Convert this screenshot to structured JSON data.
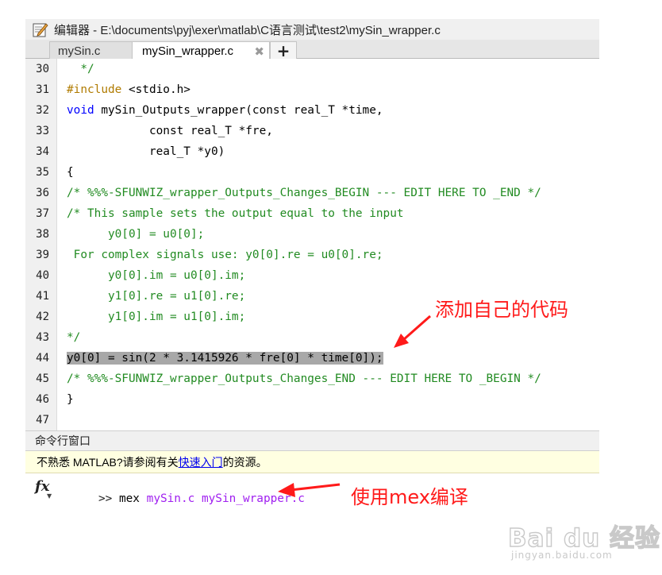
{
  "window": {
    "title": "编辑器 - E:\\documents\\pyj\\exer\\matlab\\C语言测试\\test2\\mySin_wrapper.c"
  },
  "tabs": [
    {
      "label": "mySin.c",
      "close": "✖"
    },
    {
      "label": "mySin_wrapper.c",
      "close": "✖"
    }
  ],
  "tab_add_label": "+",
  "editor": {
    "lines": [
      {
        "num": "30",
        "segments": [
          {
            "text": "  */",
            "style": "comment"
          }
        ]
      },
      {
        "num": "31",
        "segments": [
          {
            "text": "#include",
            "style": "pre"
          },
          {
            "text": " <stdio.h>",
            "style": "normal"
          }
        ]
      },
      {
        "num": "32",
        "segments": [
          {
            "text": "void",
            "style": "keyword"
          },
          {
            "text": " mySin_Outputs_wrapper(const real_T *time,",
            "style": "normal"
          }
        ]
      },
      {
        "num": "33",
        "segments": [
          {
            "text": "            const real_T *fre,",
            "style": "normal"
          }
        ]
      },
      {
        "num": "34",
        "segments": [
          {
            "text": "            real_T *y0)",
            "style": "normal"
          }
        ]
      },
      {
        "num": "35",
        "segments": [
          {
            "text": "{",
            "style": "normal"
          }
        ]
      },
      {
        "num": "36",
        "segments": [
          {
            "text": "/* %%%-SFUNWIZ_wrapper_Outputs_Changes_BEGIN --- EDIT HERE TO _END */",
            "style": "comment"
          }
        ]
      },
      {
        "num": "37",
        "segments": [
          {
            "text": "/* This sample sets the output equal to the input",
            "style": "comment"
          }
        ]
      },
      {
        "num": "38",
        "segments": [
          {
            "text": "      y0[0] = u0[0];",
            "style": "comment"
          }
        ]
      },
      {
        "num": "39",
        "segments": [
          {
            "text": " For complex signals use: y0[0].re = u0[0].re;",
            "style": "comment"
          }
        ]
      },
      {
        "num": "40",
        "segments": [
          {
            "text": "      y0[0].im = u0[0].im;",
            "style": "comment"
          }
        ]
      },
      {
        "num": "41",
        "segments": [
          {
            "text": "      y1[0].re = u1[0].re;",
            "style": "comment"
          }
        ]
      },
      {
        "num": "42",
        "segments": [
          {
            "text": "      y1[0].im = u1[0].im;",
            "style": "comment"
          }
        ]
      },
      {
        "num": "43",
        "segments": [
          {
            "text": "*/",
            "style": "comment"
          }
        ]
      },
      {
        "num": "44",
        "segments": [
          {
            "text": "y0[0] = sin(2 * 3.1415926 * fre[0] * time[0]);",
            "style": "hl"
          }
        ]
      },
      {
        "num": "45",
        "segments": [
          {
            "text": "/* %%%-SFUNWIZ_wrapper_Outputs_Changes_END --- EDIT HERE TO _BEGIN */",
            "style": "comment"
          }
        ]
      },
      {
        "num": "46",
        "segments": [
          {
            "text": "}",
            "style": "normal"
          }
        ]
      },
      {
        "num": "47",
        "segments": [
          {
            "text": "",
            "style": "normal"
          }
        ]
      }
    ]
  },
  "command_window": {
    "title": "命令行窗口",
    "info_before": "不熟悉 MATLAB?请参阅有关",
    "info_link": "快速入门",
    "info_after": "的资源。",
    "fx_label": "fx",
    "fx_arrow": "▼",
    "prompt": ">> ",
    "command": "mex",
    "arg1": "mySin.c",
    "arg2": "mySin_wrapper.c"
  },
  "annotations": {
    "code_note": "添加自己的代码",
    "mex_note": "使用mex编译"
  },
  "watermark": {
    "main": "Bai du 经验",
    "sub": "jingyan.baidu.com"
  },
  "colors": {
    "comment": "#228b22",
    "keyword": "#0000ff",
    "preprocessor": "#b07b00",
    "highlight": "#a8a8a8",
    "annotation": "#ff1a1a",
    "command_purple": "#a020f0"
  }
}
